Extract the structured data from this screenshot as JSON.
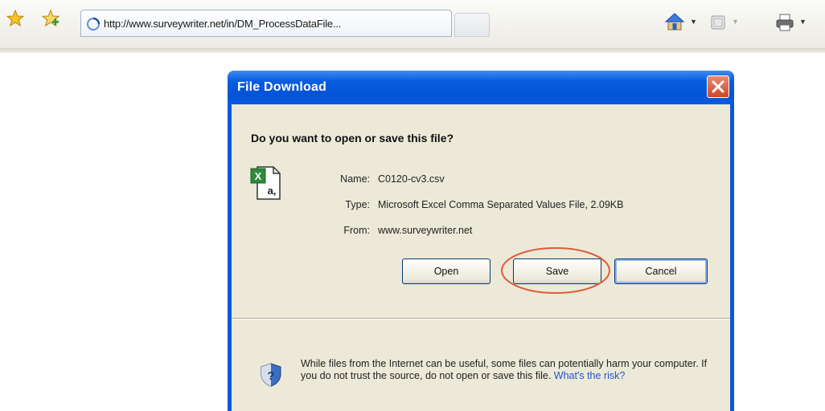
{
  "browser": {
    "tab_title": "http://www.surveywriter.net/in/DM_ProcessDataFile...",
    "toolbar_icons": [
      "favorites-star-icon",
      "add-favorites-icon",
      "home-icon",
      "feeds-icon",
      "print-icon"
    ]
  },
  "dialog": {
    "title": "File Download",
    "question": "Do you want to open or save this file?",
    "file": {
      "name_label": "Name:",
      "name_value": "C0120-cv3.csv",
      "type_label": "Type:",
      "type_value": "Microsoft Excel Comma Separated Values File, 2.09KB",
      "from_label": "From:",
      "from_value": "www.surveywriter.net"
    },
    "buttons": {
      "open": "Open",
      "save": "Save",
      "cancel": "Cancel"
    },
    "warning_text": "While files from the Internet can be useful, some files can potentially harm your computer. If you do not trust the source, do not open or save this file.",
    "risk_link": "What's the risk?"
  },
  "colors": {
    "titlebar": "#0553d6",
    "dialog_body": "#ece9d8",
    "highlight": "#e05a3a",
    "link": "#2255cc"
  }
}
